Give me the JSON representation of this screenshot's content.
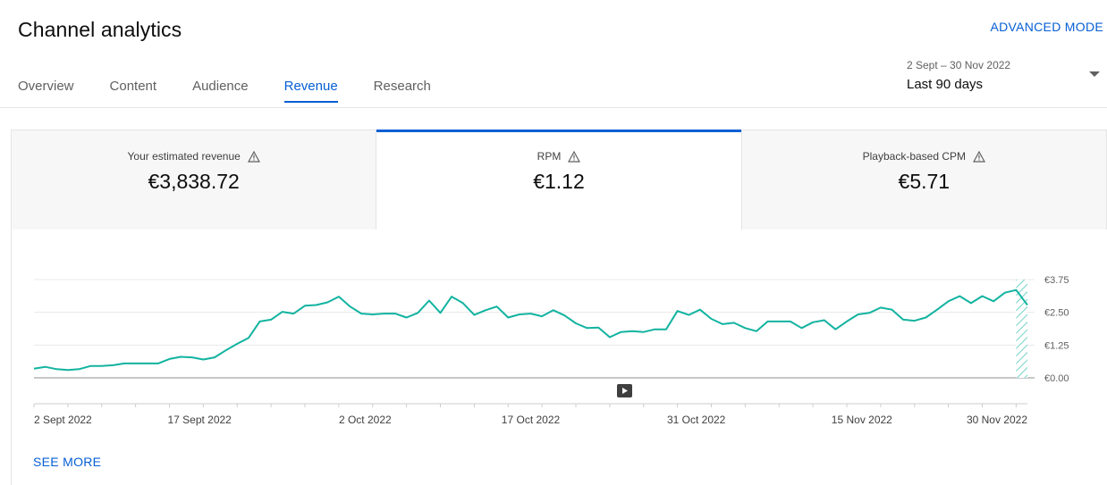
{
  "header": {
    "title": "Channel analytics",
    "advanced_mode": "ADVANCED MODE"
  },
  "tabs": [
    {
      "label": "Overview",
      "active": false
    },
    {
      "label": "Content",
      "active": false
    },
    {
      "label": "Audience",
      "active": false
    },
    {
      "label": "Revenue",
      "active": true
    },
    {
      "label": "Research",
      "active": false
    }
  ],
  "date_picker": {
    "range": "2 Sept – 30 Nov 2022",
    "label": "Last 90 days"
  },
  "metrics": [
    {
      "label": "Your estimated revenue",
      "value": "€3,838.72",
      "active": false
    },
    {
      "label": "RPM",
      "value": "€1.12",
      "active": true
    },
    {
      "label": "Playback-based CPM",
      "value": "€5.71",
      "active": false
    }
  ],
  "colors": {
    "accent": "#065fd4",
    "line": "#12b3a0"
  },
  "chart_data": {
    "type": "line",
    "x_start": "2 Sept 2022",
    "x_end": "30 Nov 2022",
    "x_tick_labels": [
      "2 Sept 2022",
      "17 Sept 2022",
      "2 Oct 2022",
      "17 Oct 2022",
      "31 Oct 2022",
      "15 Nov 2022",
      "30 Nov 2022"
    ],
    "y_tick_labels": [
      "€3.75",
      "€2.50",
      "€1.25",
      "€0.00"
    ],
    "ylim": [
      0,
      3.75
    ],
    "series": [
      {
        "values": [
          0.35,
          0.42,
          0.33,
          0.3,
          0.33,
          0.45,
          0.45,
          0.48,
          0.55,
          0.55,
          0.55,
          0.55,
          0.72,
          0.8,
          0.78,
          0.7,
          0.78,
          1.05,
          1.3,
          1.52,
          2.15,
          2.22,
          2.52,
          2.45,
          2.75,
          2.78,
          2.88,
          3.1,
          2.72,
          2.45,
          2.42,
          2.45,
          2.45,
          2.3,
          2.48,
          2.95,
          2.48,
          3.1,
          2.85,
          2.4,
          2.58,
          2.72,
          2.3,
          2.42,
          2.45,
          2.35,
          2.58,
          2.38,
          2.08,
          1.9,
          1.92,
          1.55,
          1.75,
          1.78,
          1.75,
          1.85,
          1.85,
          2.55,
          2.4,
          2.6,
          2.25,
          2.05,
          2.1,
          1.9,
          1.78,
          2.15,
          2.15,
          2.15,
          1.9,
          2.12,
          2.2,
          1.85,
          2.15,
          2.42,
          2.48,
          2.68,
          2.6,
          2.22,
          2.18,
          2.3,
          2.6,
          2.92,
          3.12,
          2.85,
          3.12,
          2.92,
          3.25,
          3.35,
          2.78
        ]
      }
    ],
    "incomplete_data_marker": true,
    "grid": true
  },
  "footer": {
    "see_more": "SEE MORE"
  }
}
